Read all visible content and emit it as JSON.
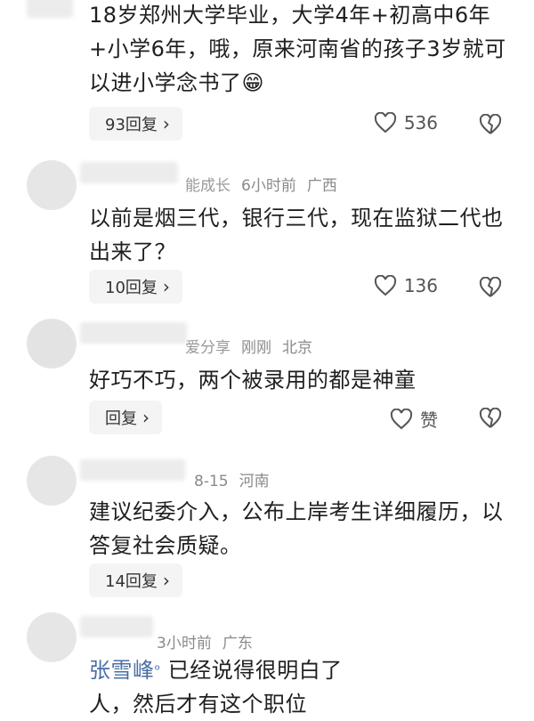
{
  "comments": [
    {
      "text": "18岁郑州大学毕业，大学4年+初高中6年+小学6年，哦，原来河南省的孩子3岁就可以进小学念书了",
      "emoji": "😁",
      "reply_label": "93回复",
      "like_count": "536"
    },
    {
      "name": "能成长",
      "time": "6小时前",
      "location": "广西",
      "text": "以前是烟三代，银行三代，现在监狱二代也出来了？",
      "reply_label": "10回复",
      "like_count": "136"
    },
    {
      "name": "爱分享",
      "time": "刚刚",
      "location": "北京",
      "text": "好巧不巧，两个被录用的都是神童",
      "reply_label": "回复",
      "like_count": "赞"
    },
    {
      "time": "8-15",
      "location": "河南",
      "text": "建议纪委介入，公布上岸考生详细履历，以答复社会质疑。",
      "reply_label": "14回复"
    },
    {
      "time": "3小时前",
      "location": "广东",
      "reply_to": "张雪峰",
      "text": "已经说得很明白了",
      "text2": "人，然后才有这个职位"
    }
  ],
  "icons": {
    "like": "heart-outline-icon",
    "dislike": "broken-heart-icon",
    "chevron": "chevron-right-icon",
    "reply_marker": "search-person-icon"
  }
}
